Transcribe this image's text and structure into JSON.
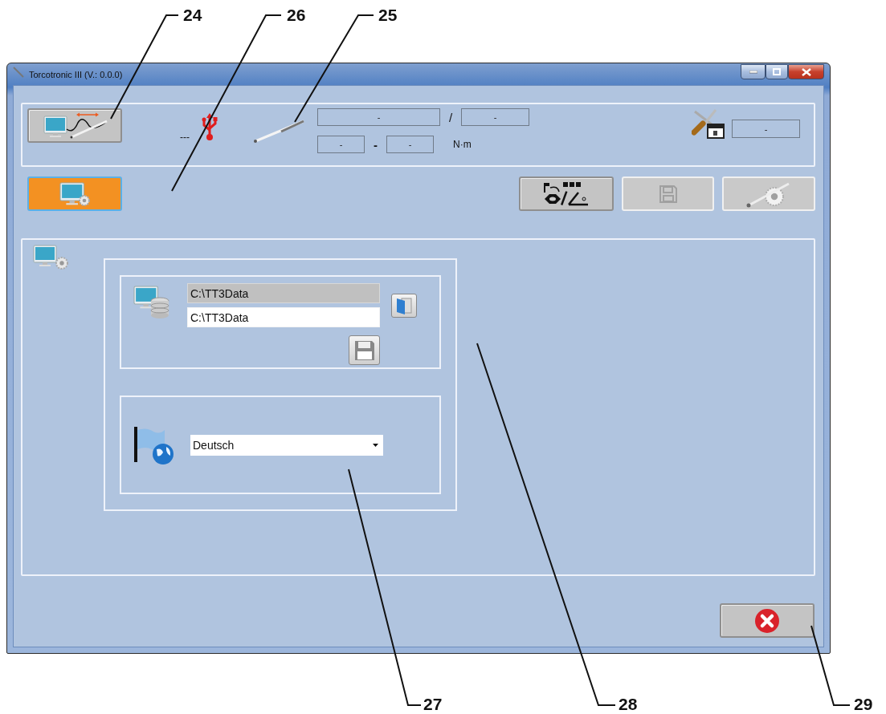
{
  "window": {
    "title": "Torcotronic III (V.: 0.0.0)"
  },
  "status_panel": {
    "connection_text": "---",
    "serial_number": "-",
    "serial_separator": "/",
    "serial_number_2": "-",
    "range_min": "-",
    "range_separator": "-",
    "range_max": "-",
    "unit": "N·m",
    "calibration_date": "-"
  },
  "toolbar": {
    "mode_button": {
      "selected": true
    },
    "actions": [
      {
        "kind": "sequence",
        "disabled": false
      },
      {
        "kind": "save",
        "disabled": true
      },
      {
        "kind": "tool-settings",
        "disabled": true
      }
    ]
  },
  "settings": {
    "paths": [
      {
        "value": "C:\\TT3Data",
        "readonly": true
      },
      {
        "value": "C:\\TT3Data",
        "readonly": false
      }
    ],
    "language": {
      "value": "Deutsch"
    }
  },
  "callouts": [
    {
      "label": "24"
    },
    {
      "label": "26"
    },
    {
      "label": "25"
    },
    {
      "label": "27"
    },
    {
      "label": "28"
    },
    {
      "label": "29"
    }
  ]
}
